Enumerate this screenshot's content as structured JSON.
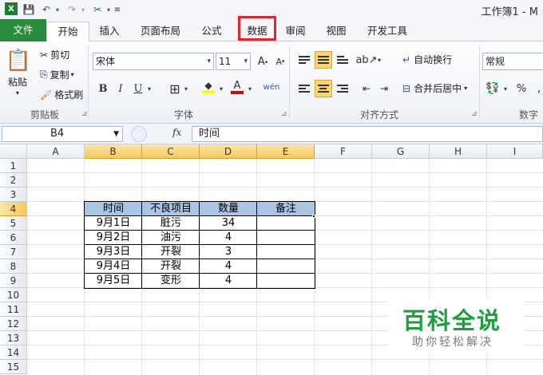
{
  "window": {
    "title": "工作簿1 - M"
  },
  "ribbon": {
    "tabs": [
      "文件",
      "开始",
      "插入",
      "页面布局",
      "公式",
      "数据",
      "审阅",
      "视图",
      "开发工具"
    ],
    "active_tab": "开始",
    "highlighted_tab": "数据",
    "clipboard": {
      "paste": "粘贴",
      "cut": "剪切",
      "copy": "复制",
      "format_painter": "格式刷",
      "label": "剪贴板"
    },
    "font": {
      "name": "宋体",
      "size": "11",
      "bold": "B",
      "italic": "I",
      "underline": "U",
      "label": "字体"
    },
    "alignment": {
      "wrap": "自动换行",
      "merge": "合并后居中",
      "label": "对齐方式"
    },
    "number": {
      "format": "常规",
      "percent": "%",
      "label": "数字"
    }
  },
  "formula_bar": {
    "name_box": "B4",
    "fx": "fx",
    "content": "时间"
  },
  "sheet": {
    "columns": [
      "A",
      "B",
      "C",
      "D",
      "E",
      "F",
      "G",
      "H",
      "I"
    ],
    "rows": [
      "1",
      "2",
      "3",
      "4",
      "5",
      "6",
      "7",
      "8",
      "9",
      "10",
      "11",
      "12",
      "13",
      "14",
      "15"
    ],
    "table": {
      "headers": [
        "时间",
        "不良项目",
        "数量",
        "备注"
      ],
      "rows": [
        [
          "9月1日",
          "脏污",
          "34",
          ""
        ],
        [
          "9月2日",
          "油污",
          "4",
          ""
        ],
        [
          "9月3日",
          "开裂",
          "3",
          ""
        ],
        [
          "9月4日",
          "开裂",
          "4",
          ""
        ],
        [
          "9月5日",
          "变形",
          "4",
          ""
        ]
      ]
    }
  },
  "watermark": {
    "title": "百科全说",
    "subtitle": "助你轻松解决"
  },
  "colors": {
    "file_tab": "#2a8a3e",
    "highlight_box": "#e0262d",
    "header_fill": "#a9c4e4",
    "watermark_green": "#1e9e3c"
  }
}
